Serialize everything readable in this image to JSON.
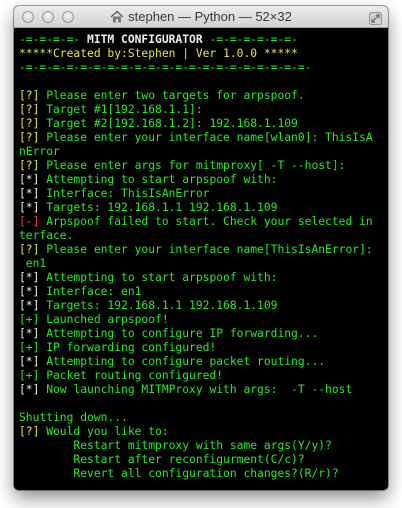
{
  "window": {
    "title": "stephen — Python — 52×32"
  },
  "terminal": {
    "header": [
      {
        "text": "-=-=-=-=- MITM CONFIGURATOR -=-=-=-=-=-=-",
        "parts": [
          {
            "text": "-=-=-=-=- ",
            "color": "green"
          },
          {
            "text": "MITM CONFIGURATOR",
            "color": "white",
            "bold": true
          },
          {
            "text": " -=-=-=-=-=-=-",
            "color": "green"
          }
        ]
      },
      {
        "text": "*****Created by:Stephen | Ver 1.0.0 *****",
        "color": "yellow"
      },
      {
        "text": "-=-=-=-=-=-=-=-=-=-=-=-=-=-=-=-=-=-=-=-=-=-",
        "color": "green"
      },
      {
        "text": "",
        "color": "green"
      }
    ],
    "lines": [
      {
        "prefix": "[?]",
        "prefix_color": "yellow",
        "text": " Please enter two targets for arpspoof.",
        "color": "green"
      },
      {
        "prefix": "[?]",
        "prefix_color": "yellow",
        "text": " Target #1[192.168.1.1]:",
        "color": "green"
      },
      {
        "prefix": "[?]",
        "prefix_color": "yellow",
        "text": " Target #2[192.168.1.2]: 192.168.1.109",
        "color": "green"
      },
      {
        "prefix": "[?]",
        "prefix_color": "yellow",
        "text": " Please enter your interface name[wlan0]: ThisIsA",
        "color": "green"
      },
      {
        "prefix": "",
        "prefix_color": "green",
        "text": "nError",
        "color": "green"
      },
      {
        "prefix": "[?]",
        "prefix_color": "yellow",
        "text": " Please enter args for mitmproxy[ -T --host]:",
        "color": "green"
      },
      {
        "prefix": "[*]",
        "prefix_color": "white",
        "text": " Attempting to start arpspoof with:",
        "color": "green"
      },
      {
        "prefix": "[*]",
        "prefix_color": "white",
        "text": " Interface: ThisIsAnError",
        "color": "green"
      },
      {
        "prefix": "[*]",
        "prefix_color": "white",
        "text": " Targets: 192.168.1.1 192.168.1.109",
        "color": "green"
      },
      {
        "prefix": "[-]",
        "prefix_color": "red",
        "text": " Arpspoof failed to start. Check your selected in",
        "color": "green"
      },
      {
        "prefix": "",
        "prefix_color": "green",
        "text": "terface.",
        "color": "green"
      },
      {
        "prefix": "[?]",
        "prefix_color": "yellow",
        "text": " Please enter your interface name[ThisIsAnError]:",
        "color": "green"
      },
      {
        "prefix": "",
        "prefix_color": "green",
        "text": " en1",
        "color": "green"
      },
      {
        "prefix": "[*]",
        "prefix_color": "white",
        "text": " Attempting to start arpspoof with:",
        "color": "green"
      },
      {
        "prefix": "[*]",
        "prefix_color": "white",
        "text": " Interface: en1",
        "color": "green"
      },
      {
        "prefix": "[*]",
        "prefix_color": "white",
        "text": " Targets: 192.168.1.1 192.168.1.109",
        "color": "green"
      },
      {
        "prefix": "[+]",
        "prefix_color": "green",
        "text": " Launched arpspoof!",
        "color": "green"
      },
      {
        "prefix": "[*]",
        "prefix_color": "white",
        "text": " Attempting to configure IP forwarding...",
        "color": "green"
      },
      {
        "prefix": "[+]",
        "prefix_color": "green",
        "text": " IP forwarding configured!",
        "color": "green"
      },
      {
        "prefix": "[*]",
        "prefix_color": "white",
        "text": " Attempting to configure packet routing...",
        "color": "green"
      },
      {
        "prefix": "[+]",
        "prefix_color": "green",
        "text": " Packet routing configured!",
        "color": "green"
      },
      {
        "prefix": "[*]",
        "prefix_color": "white",
        "text": " Now launching MITMProxy with args:  -T --host",
        "color": "green"
      },
      {
        "prefix": "",
        "prefix_color": "green",
        "text": "",
        "color": "green"
      },
      {
        "prefix": "",
        "prefix_color": "green",
        "text": "Shutting down...",
        "color": "green"
      },
      {
        "prefix": "[?]",
        "prefix_color": "yellow",
        "text": " Would you like to:",
        "color": "green"
      },
      {
        "prefix": "",
        "prefix_color": "green",
        "text": "        Restart mitmproxy with same args(Y/y)?",
        "color": "green"
      },
      {
        "prefix": "",
        "prefix_color": "green",
        "text": "        Restart after reconfigurment(C/c)?",
        "color": "green"
      },
      {
        "prefix": "",
        "prefix_color": "green",
        "text": "        Revert all configuration changes?(R/r)?",
        "color": "green"
      }
    ]
  },
  "colors": {
    "green": "#22ee22",
    "yellow": "#e8e838",
    "red": "#ff4040",
    "white": "#f0f0f0",
    "background": "#000000"
  },
  "icons": [
    "close-button-icon",
    "minimize-button-icon",
    "zoom-button-icon",
    "home-folder-icon",
    "fullscreen-arrows-icon"
  ]
}
